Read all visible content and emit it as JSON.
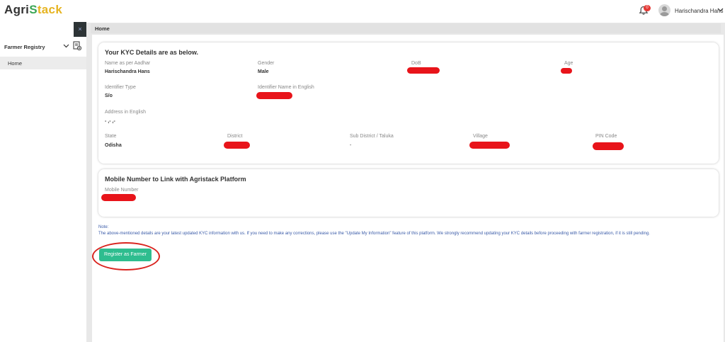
{
  "header": {
    "logo_part1": "Agri",
    "logo_s": "S",
    "logo_part2": "tack",
    "notification_count": "0",
    "user_name": "Harischandra Hans"
  },
  "sidebar": {
    "close_symbol": "×",
    "section_title": "Farmer Registry",
    "items": [
      {
        "label": "Home"
      }
    ]
  },
  "breadcrumb": "Home",
  "kyc": {
    "title": "Your KYC Details are as below.",
    "name_label": "Name as per Aadhar",
    "name_value": "Harischandra Hans",
    "gender_label": "Gender",
    "gender_value": "Male",
    "dob_label": "DoB",
    "age_label": "Age",
    "identifier_type_label": "Identifier Type",
    "identifier_type_value": "S/o",
    "identifier_name_label": "Identifier Name in English",
    "address_label": "Address in English",
    "address_value": "- ,- ,-",
    "state_label": "State",
    "state_value": "Odisha",
    "district_label": "District",
    "subdistrict_label": "Sub District / Taluka",
    "subdistrict_value": "-",
    "village_label": "Village",
    "pincode_label": "PIN Code"
  },
  "mobile": {
    "title": "Mobile Number to Link with Agristack Platform",
    "label": "Mobile Number"
  },
  "note": {
    "heading": "Note:",
    "text": "The above-mentioned details are your latest updated KYC information with us. If you need to make any corrections, please use the \"Update My Information\" feature of this platform. We strongly recommend updating your KYC details before proceeding with farmer registration, if it is still pending."
  },
  "actions": {
    "register_label": "Register as Farmer"
  },
  "colors": {
    "accent": "#2ebd8f",
    "annotation": "#d9241f",
    "note_text": "#3a5ba8"
  },
  "icons": [
    "bell-icon",
    "avatar-icon",
    "chevron-down-icon",
    "close-icon",
    "file-add-icon"
  ]
}
